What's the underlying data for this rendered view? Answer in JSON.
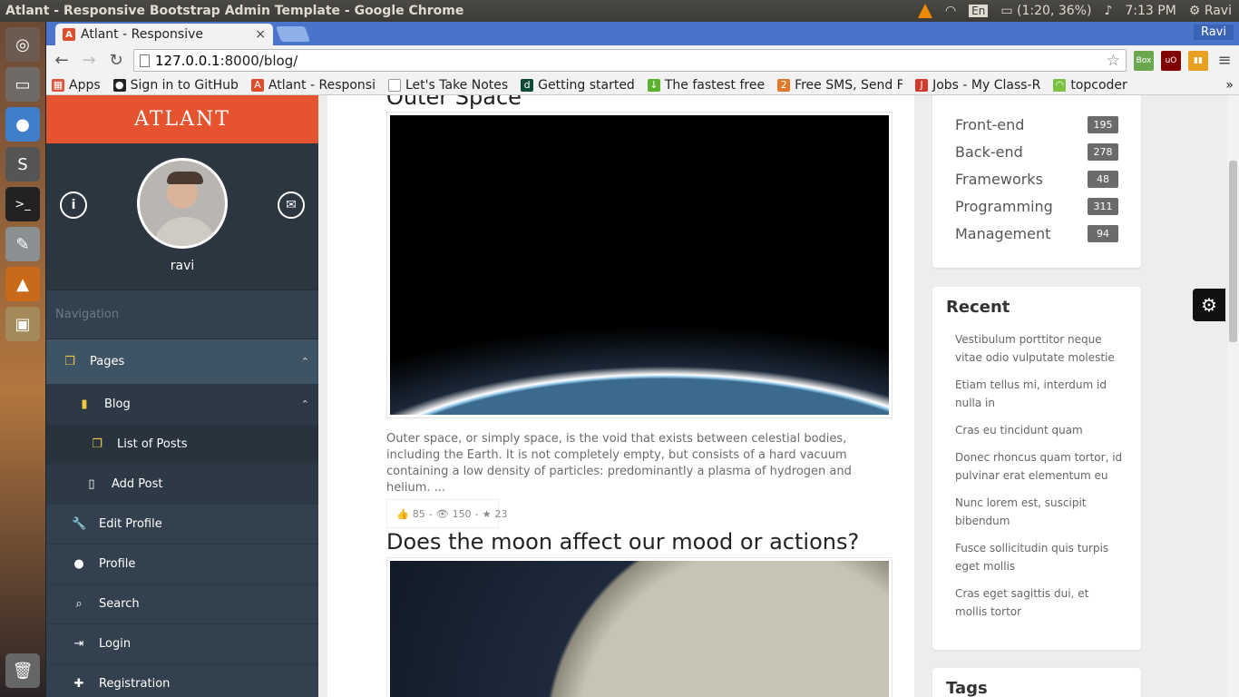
{
  "os_panel": {
    "window_title": "Atlant - Responsive Bootstrap Admin Template - Google Chrome",
    "input_lang": "En",
    "battery": "(1:20, 36%)",
    "clock": "7:13 PM",
    "user": "Ravi"
  },
  "browser": {
    "tab_title": "Atlant - Responsive",
    "tab_close": "×",
    "profile_name": "Ravi",
    "url_host": "127.0.0.1",
    "url_path": ":8000/blog/",
    "bookmarks": [
      {
        "label": "Apps",
        "icon": "apps-grid-icon",
        "color": "#e0533c"
      },
      {
        "label": "Sign in to GitHub",
        "icon": "github-icon",
        "color": "#222222"
      },
      {
        "label": "Atlant - Responsi",
        "icon": "atlant-icon",
        "color": "#e04b2a"
      },
      {
        "label": "Let's Take Notes",
        "icon": "page-icon",
        "color": "#999999"
      },
      {
        "label": "Getting started",
        "icon": "django-icon",
        "color": "#0c4b33"
      },
      {
        "label": "The fastest free",
        "icon": "download-icon",
        "color": "#5ab22e"
      },
      {
        "label": "Free SMS, Send F",
        "icon": "sms-icon",
        "color": "#e07a2a"
      },
      {
        "label": "Jobs - My Class-R",
        "icon": "jobs-icon",
        "color": "#d33a2c"
      },
      {
        "label": "topcoder",
        "icon": "topcoder-icon",
        "color": "#7cc242"
      }
    ],
    "extensions": [
      {
        "name": "boxon-extension-icon",
        "text": "Box",
        "color": "#6aa84f"
      },
      {
        "name": "ublock-extension-icon",
        "text": "uO",
        "color": "#800000"
      },
      {
        "name": "stats-extension-icon",
        "text": "▮▮",
        "color": "#e8a020"
      }
    ]
  },
  "sidebar": {
    "logo": "ATLANT",
    "username": "ravi",
    "nav_title": "Navigation",
    "items": [
      {
        "label": "Pages"
      },
      {
        "label": "Blog"
      },
      {
        "label": "List of Posts"
      },
      {
        "label": "Add Post"
      },
      {
        "label": "Edit Profile"
      },
      {
        "label": "Profile"
      },
      {
        "label": "Search"
      },
      {
        "label": "Login"
      },
      {
        "label": "Registration"
      }
    ]
  },
  "main": {
    "post1_title": "Outer Space",
    "post1_excerpt": "Outer space, or simply space, is the void that exists between celestial bodies, including the Earth. It is not completely empty, but consists of a hard vacuum containing a low density of particles: predominantly a plasma of hydrogen and helium. ...",
    "post1_stats": {
      "likes": "85",
      "views": "150",
      "stars": "23"
    },
    "post2_title": "Does the moon affect our mood or actions?"
  },
  "categories": [
    {
      "name": "Front-end",
      "count": "195"
    },
    {
      "name": "Back-end",
      "count": "278"
    },
    {
      "name": "Frameworks",
      "count": "48"
    },
    {
      "name": "Programming",
      "count": "311"
    },
    {
      "name": "Management",
      "count": "94"
    }
  ],
  "recent": {
    "title": "Recent",
    "items": [
      "Vestibulum porttitor neque vitae odio vulputate molestie",
      "Etiam tellus mi, interdum id nulla in",
      "Cras eu tincidunt quam",
      "Donec rhoncus quam tortor, id pulvinar erat elementum eu",
      "Nunc lorem est, suscipit bibendum",
      "Fusce sollicitudin quis turpis eget mollis",
      "Cras eget sagittis dui, et mollis tortor"
    ]
  },
  "tags": {
    "title": "Tags"
  }
}
